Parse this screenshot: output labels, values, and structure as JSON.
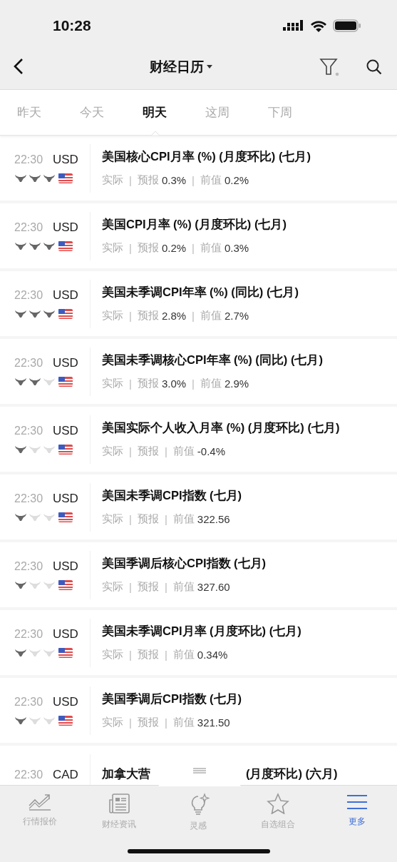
{
  "status_bar": {
    "time": "10:28"
  },
  "nav": {
    "title": "财经日历"
  },
  "tabs": [
    {
      "label": "昨天",
      "selected": false
    },
    {
      "label": "今天",
      "selected": false
    },
    {
      "label": "明天",
      "selected": true
    },
    {
      "label": "这周",
      "selected": false
    },
    {
      "label": "下周",
      "selected": false
    }
  ],
  "events": [
    {
      "time": "22:30",
      "currency": "USD",
      "stars": 3,
      "title": "美国核心CPI月率 (%) (月度环比) (七月)",
      "actual": "实际",
      "forecast_label": "预报",
      "forecast": "0.3%",
      "previous_label": "前值",
      "previous": "0.2%",
      "separator_1": "|",
      "separator_2": "|"
    },
    {
      "time": "22:30",
      "currency": "USD",
      "stars": 3,
      "title": "美国CPI月率 (%) (月度环比) (七月)",
      "actual": "实际",
      "forecast_label": "预报",
      "forecast": "0.2%",
      "previous_label": "前值",
      "previous": "0.3%",
      "separator_1": "|",
      "separator_2": "|"
    },
    {
      "time": "22:30",
      "currency": "USD",
      "stars": 3,
      "title": "美国未季调CPI年率 (%) (同比) (七月)",
      "actual": "实际",
      "forecast_label": "预报",
      "forecast": "2.8%",
      "previous_label": "前值",
      "previous": "2.7%",
      "separator_1": "|",
      "separator_2": "|"
    },
    {
      "time": "22:30",
      "currency": "USD",
      "stars": 2,
      "title": "美国未季调核心CPI年率 (%) (同比) (七月)",
      "actual": "实际",
      "forecast_label": "预报",
      "forecast": "3.0%",
      "previous_label": "前值",
      "previous": "2.9%",
      "separator_1": "|",
      "separator_2": "|"
    },
    {
      "time": "22:30",
      "currency": "USD",
      "stars": 1,
      "title": "美国实际个人收入月率 (%) (月度环比) (七月)",
      "actual": "实际",
      "forecast_label": "预报",
      "previous_label": "前值",
      "previous": "-0.4%",
      "separator_1": "|",
      "separator_2": "|"
    },
    {
      "time": "22:30",
      "currency": "USD",
      "stars": 1,
      "title": "美国未季调CPI指数 (七月)",
      "actual": "实际",
      "forecast_label": "预报",
      "previous_label": "前值",
      "previous": "322.56",
      "separator_1": "|",
      "separator_2": "|"
    },
    {
      "time": "22:30",
      "currency": "USD",
      "stars": 1,
      "title": "美国季调后核心CPI指数 (七月)",
      "actual": "实际",
      "forecast_label": "预报",
      "previous_label": "前值",
      "previous": "327.60",
      "separator_1": "|",
      "separator_2": "|"
    },
    {
      "time": "22:30",
      "currency": "USD",
      "stars": 1,
      "title": "美国未季调CPI月率 (月度环比) (七月)",
      "actual": "实际",
      "forecast_label": "预报",
      "previous_label": "前值",
      "previous": "0.34%",
      "separator_1": "|",
      "separator_2": "|"
    },
    {
      "time": "22:30",
      "currency": "USD",
      "stars": 1,
      "title": "美国季调后CPI指数 (七月)",
      "actual": "实际",
      "forecast_label": "预报",
      "previous_label": "前值",
      "previous": "321.50",
      "separator_1": "|",
      "separator_2": "|"
    }
  ],
  "partial_event": {
    "time": "22:30",
    "currency": "CAD",
    "title_start": "加拿大营",
    "title_end": "(月度环比) (六月)"
  },
  "tab_bar": [
    {
      "label": "行情报价",
      "kind": "chart",
      "selected": false
    },
    {
      "label": "财经资讯",
      "kind": "news",
      "selected": false
    },
    {
      "label": "灵感",
      "kind": "bulb",
      "selected": false
    },
    {
      "label": "自选组合",
      "kind": "star",
      "selected": false
    },
    {
      "label": "更多",
      "kind": "menu",
      "selected": true
    }
  ]
}
